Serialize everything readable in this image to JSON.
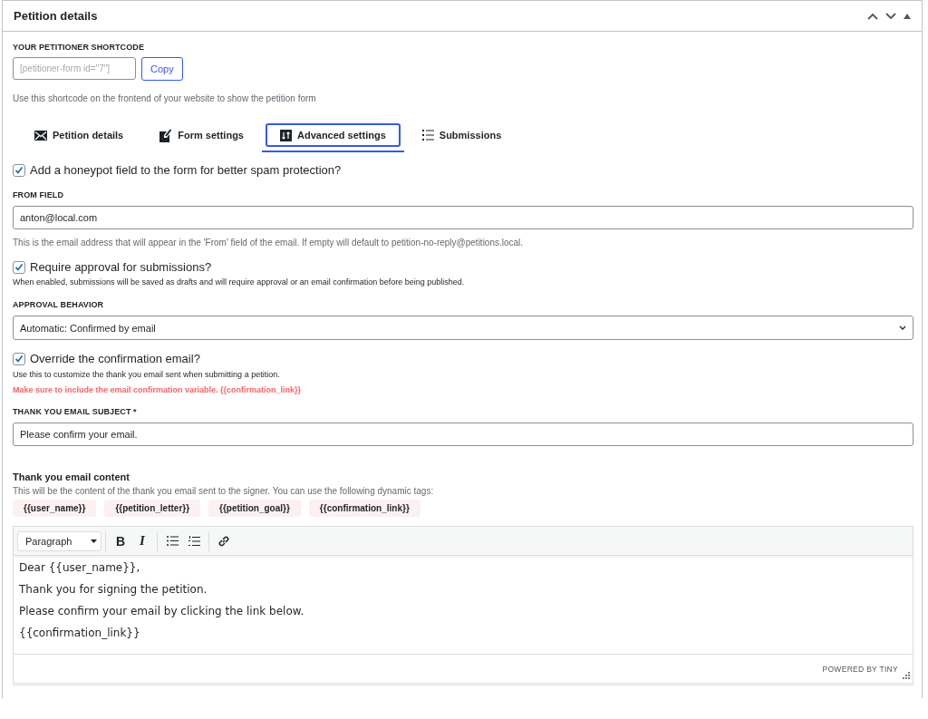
{
  "panel": {
    "title": "Petition details"
  },
  "shortcode": {
    "label": "YOUR PETITIONER SHORTCODE",
    "placeholder": "[petitioner-form id=\"7\"]",
    "button": "Copy",
    "help": "Use this shortcode on the frontend of your website to show the petition form"
  },
  "tabs": [
    {
      "label": "Petition details",
      "selected": false
    },
    {
      "label": "Form settings",
      "selected": false
    },
    {
      "label": "Advanced settings",
      "selected": true
    },
    {
      "label": "Submissions",
      "selected": false
    }
  ],
  "honeypot": {
    "label": "Add a honeypot field to the form for better spam protection?",
    "checked": true
  },
  "from_field": {
    "label": "FROM FIELD",
    "value": "anton@local.com",
    "help": "This is the email address that will appear in the 'From' field of the email. If empty will default to petition-no-reply@petitions.local."
  },
  "require_approval": {
    "label": "Require approval for submissions?",
    "checked": true,
    "help": "When enabled, submissions will be saved as drafts and will require approval or an email confirmation before being published."
  },
  "approval_behavior": {
    "label": "APPROVAL BEHAVIOR",
    "value": "Automatic: Confirmed by email"
  },
  "override_confirmation": {
    "label": "Override the confirmation email?",
    "checked": true,
    "help": "Use this to customize the thank you email sent when submitting a petition.",
    "warning": "Make sure to include the email confirmation variable. {{confirmation_link}}"
  },
  "subject": {
    "label": "THANK YOU EMAIL SUBJECT *",
    "value": "Please confirm your email."
  },
  "content": {
    "title": "Thank you email content",
    "help": "This will be the content of the thank you email sent to the signer. You can use the following dynamic tags:",
    "tags": [
      "{{user_name}}",
      "{{petition_letter}}",
      "{{petition_goal}}",
      "{{confirmation_link}}"
    ],
    "editor": {
      "format": "Paragraph",
      "bold": "B",
      "italic": "I",
      "paragraphs": [
        "Dear {{user_name}},",
        "Thank you for signing the petition.",
        "Please confirm your email by clicking the link below.",
        "{{confirmation_link}}"
      ],
      "footer": "POWERED BY TINY"
    }
  }
}
